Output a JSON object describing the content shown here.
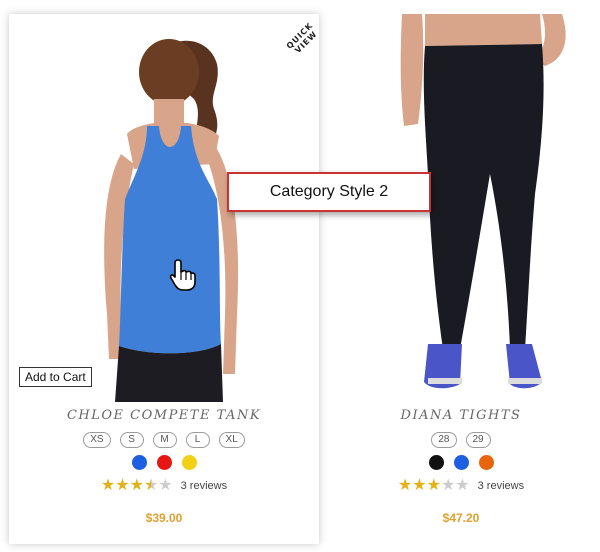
{
  "callout": {
    "text": "Category Style 2"
  },
  "products": [
    {
      "quick_view": "QUICK VIEW",
      "add_to_cart": "Add to Cart",
      "name": "CHLOE COMPETE TANK",
      "sizes": [
        "XS",
        "S",
        "M",
        "L",
        "XL"
      ],
      "colors": [
        "#1d5fe0",
        "#e81515",
        "#f2d015"
      ],
      "rating": 3.5,
      "reviews": "3 reviews",
      "price": "$39.00"
    },
    {
      "name": "DIANA TIGHTS",
      "sizes": [
        "28",
        "29"
      ],
      "colors": [
        "#111111",
        "#1d5fe0",
        "#e8650e"
      ],
      "rating": 3,
      "reviews": "3 reviews",
      "price": "$47.20"
    }
  ],
  "icons": {
    "cursor": "hand-pointer-icon"
  }
}
